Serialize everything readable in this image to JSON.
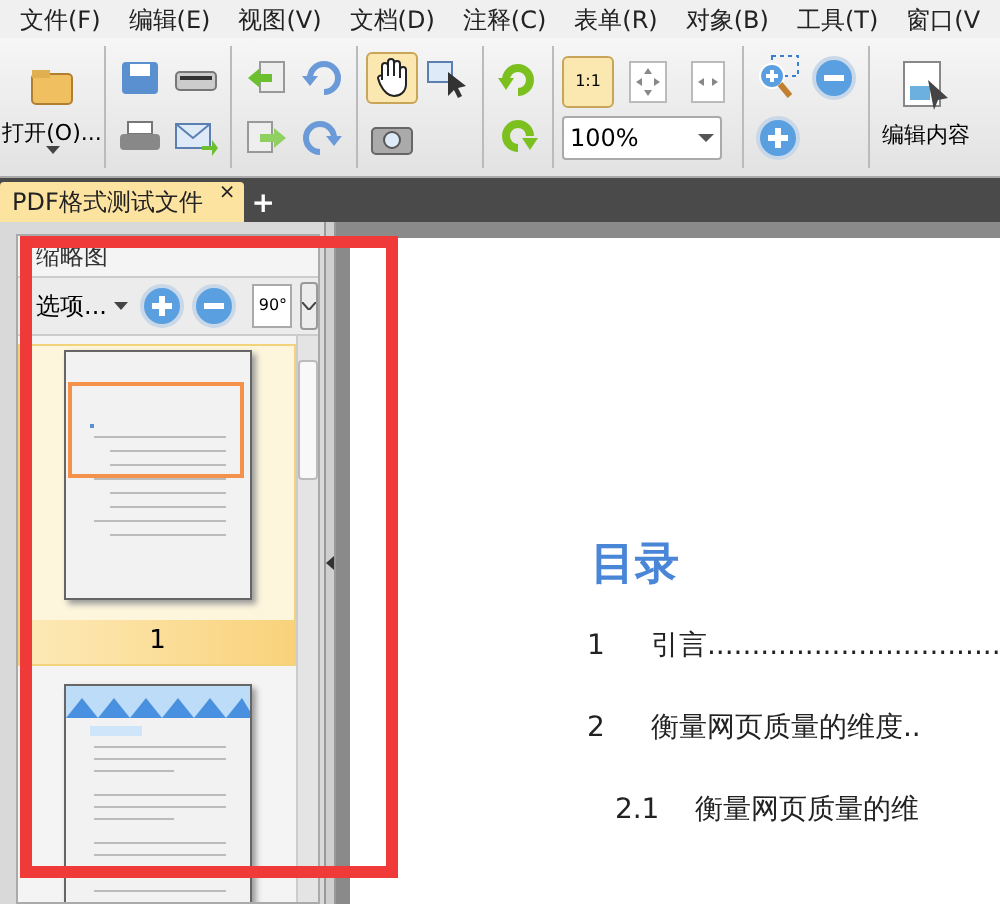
{
  "menu": [
    "文件(F)",
    "编辑(E)",
    "视图(V)",
    "文档(D)",
    "注释(C)",
    "表单(R)",
    "对象(B)",
    "工具(T)",
    "窗口(V"
  ],
  "toolbar": {
    "open_label": "打开(O)...",
    "zoom_value": "100%",
    "actual_size_label": "1:1",
    "actual_size_selected": true,
    "hand_selected": true,
    "edit_label": "编辑内容"
  },
  "tabs": [
    {
      "label": "PDF格式测试文件",
      "selected": true,
      "close": "×"
    }
  ],
  "new_tab": "+",
  "thumbnail_panel": {
    "title": "缩略图",
    "options_label": "选项...",
    "rotate_label": "90°",
    "pages": [
      {
        "label": "1",
        "selected": true,
        "kind": "toc"
      },
      {
        "selected": false,
        "kind": "text"
      }
    ]
  },
  "document": {
    "heading": "目录",
    "toc": [
      {
        "number": "1",
        "title": "引言................................."
      },
      {
        "number": "2",
        "title": "衡量网页质量的维度..",
        "children": [
          {
            "number": "2.1",
            "title": "衡量网页质量的维"
          }
        ]
      }
    ]
  }
}
